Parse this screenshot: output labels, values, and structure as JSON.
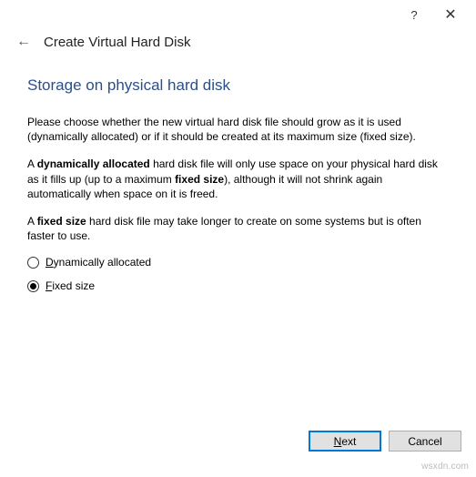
{
  "titlebar": {
    "help_label": "?",
    "close_label": "✕"
  },
  "header": {
    "back_glyph": "←",
    "title": "Create Virtual Hard Disk"
  },
  "page": {
    "heading": "Storage on physical hard disk",
    "p1_a": "Please choose whether the new virtual hard disk file should grow as it is used (dynamically allocated) or if it should be created at its maximum size (fixed size).",
    "p2_a": "A ",
    "p2_b": "dynamically allocated",
    "p2_c": " hard disk file will only use space on your physical hard disk as it fills up (up to a maximum ",
    "p2_d": "fixed size",
    "p2_e": "), although it will not shrink again automatically when space on it is freed.",
    "p3_a": "A ",
    "p3_b": "fixed size",
    "p3_c": " hard disk file may take longer to create on some systems but is often faster to use."
  },
  "options": {
    "dyn_mnemonic": "D",
    "dyn_rest": "ynamically allocated",
    "fixed_mnemonic": "F",
    "fixed_rest": "ixed size",
    "selected": "fixed"
  },
  "footer": {
    "next_mnemonic": "N",
    "next_rest": "ext",
    "cancel_label": "Cancel"
  },
  "watermark": "wsxdn.com"
}
